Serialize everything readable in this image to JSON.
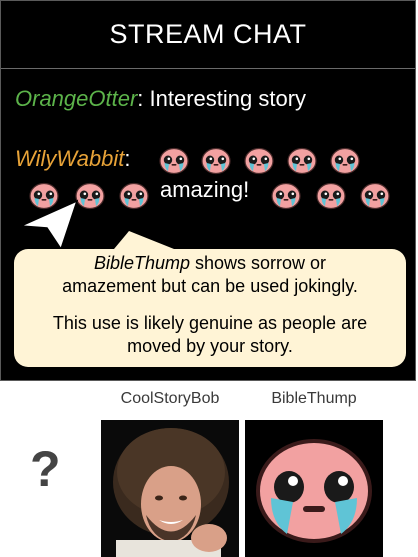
{
  "chat": {
    "title": "STREAM CHAT",
    "messages": [
      {
        "user": "OrangeOtter",
        "user_color": "#5cb34a",
        "separator": ":",
        "text": " Interesting story"
      },
      {
        "user": "WilyWabbit",
        "user_color": "#e8a338",
        "separator": ":",
        "text_word": "amazing!",
        "emote": "BibleThump"
      }
    ]
  },
  "tooltip": {
    "emote_name": "BibleThump",
    "line1_rest": " shows sorrow or",
    "line2": "amazement but can be used jokingly.",
    "line3": "This use is likely genuine as people are",
    "line4": "moved by your story."
  },
  "options": {
    "question_mark": "?",
    "choices": [
      {
        "label": "CoolStoryBob",
        "icon": "bob-ross-portrait"
      },
      {
        "label": "BibleThump",
        "icon": "crying-face-emote"
      }
    ]
  },
  "colors": {
    "tooltip_bg": "#fff4d6",
    "emote_face": "#f2a1a1",
    "tear": "#5fc4d6"
  }
}
